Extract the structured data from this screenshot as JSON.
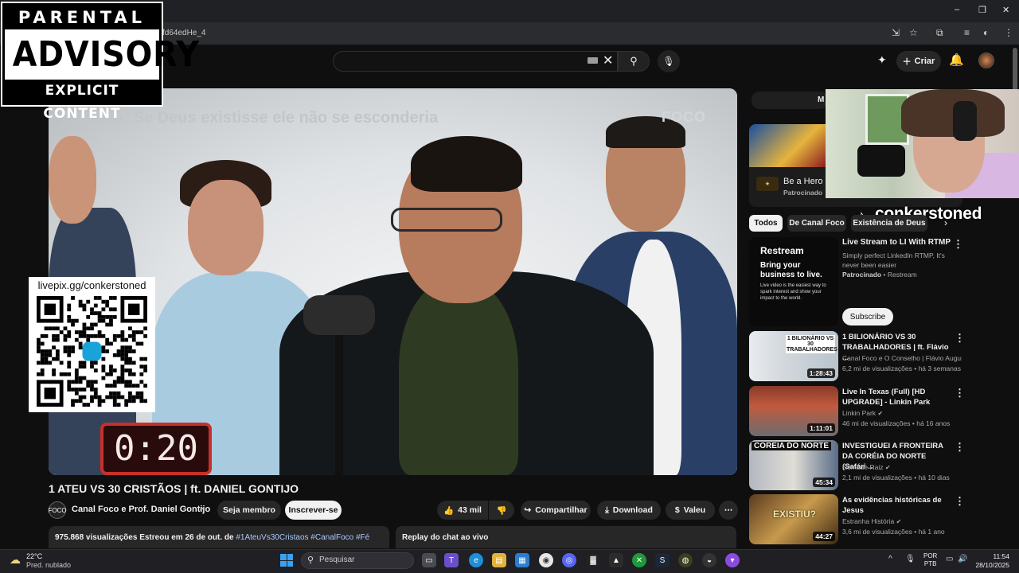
{
  "browser": {
    "url_fragment": "fd64edHe_4",
    "window_controls": [
      "–",
      "❐",
      "✕"
    ]
  },
  "parental_advisory": {
    "line1": "PARENTAL",
    "line2": "ADVISORY",
    "line3": "EXPLICIT CONTENT"
  },
  "header": {
    "create_label": "Criar"
  },
  "video": {
    "overlay_caption": "Pauta: Se Deus existisse ele não se esconderia",
    "watermark": "FOCO",
    "timer": "0:20",
    "title": "1 ATEU VS 30 CRISTÃOS | ft. DANIEL GONTIJO"
  },
  "qr": {
    "label": "livepix.gg/conkerstoned"
  },
  "channel": {
    "name": "Canal Foco e Prof. Daniel Gontijo",
    "join_label": "Seja membro",
    "subscribe_label": "Inscrever-se"
  },
  "actions": {
    "likes": "43 mil",
    "share": "Compartilhar",
    "download": "Download",
    "thanks": "Valeu"
  },
  "description": {
    "views": "975.868 visualizações",
    "premiered": "Estreou em 26 de out. de",
    "tags": "#1AteuVs30Cristaos #CanalFoco #Fé"
  },
  "chat": {
    "label": "Replay do chat ao vivo"
  },
  "sidebar": {
    "members_tab": "M",
    "ad": {
      "title": "Be a Hero",
      "sponsor": "Patrocinado"
    },
    "streamer": "conkerstoned",
    "chips": [
      "Todos",
      "De Canal Foco",
      "Existência de Deus"
    ],
    "restream": {
      "brand": "Restream",
      "headline": "Bring your business to live.",
      "small": "Live video is the easiest way to spark interest and show your impact to the world.",
      "title": "Live Stream to LI With RTMP",
      "desc": "Simply perfect LinkedIn RTMP, It's never been easier",
      "sponsor_label": "Patrocinado",
      "sponsor_name": "Restream",
      "subscribe": "Subscribe"
    },
    "recommended": [
      {
        "title": "1 BILIONÁRIO VS 30 TRABALHADORES | ft. Flávio ...",
        "channel": "Canal Foco e O Conselho | Flávio August...",
        "stats": "6,2 mi de visualizações • há 3 semanas",
        "duration": "1:28:43",
        "thumb_text": "1 BILIONÁRIO VS 30 TRABALHADORES"
      },
      {
        "title": "Live In Texas (Full) [HD UPGRADE] - Linkin Park",
        "channel": "Linkin Park",
        "stats": "46 mi de visualizações • há 16 anos",
        "duration": "1:11:01",
        "thumb_text": ""
      },
      {
        "title": "INVESTIGUEI A FRONTEIRA DA CORÉIA DO NORTE (Safári ...",
        "channel": "Nômade Raiz",
        "stats": "2,1 mi de visualizações • há 10 dias",
        "duration": "45:34",
        "thumb_text": "COREIA DO NORTE"
      },
      {
        "title": "As evidências históricas de Jesus",
        "channel": "Estranha História",
        "stats": "3,6 mi de visualizações • há 1 ano",
        "duration": "44:27",
        "thumb_text": "EXISTIU?"
      }
    ]
  },
  "taskbar": {
    "temp": "22°C",
    "weather": "Pred. nublado",
    "search_placeholder": "Pesquisar",
    "lang1": "POR",
    "lang2": "PTB",
    "time": "11:54",
    "date": "28/10/2025"
  }
}
